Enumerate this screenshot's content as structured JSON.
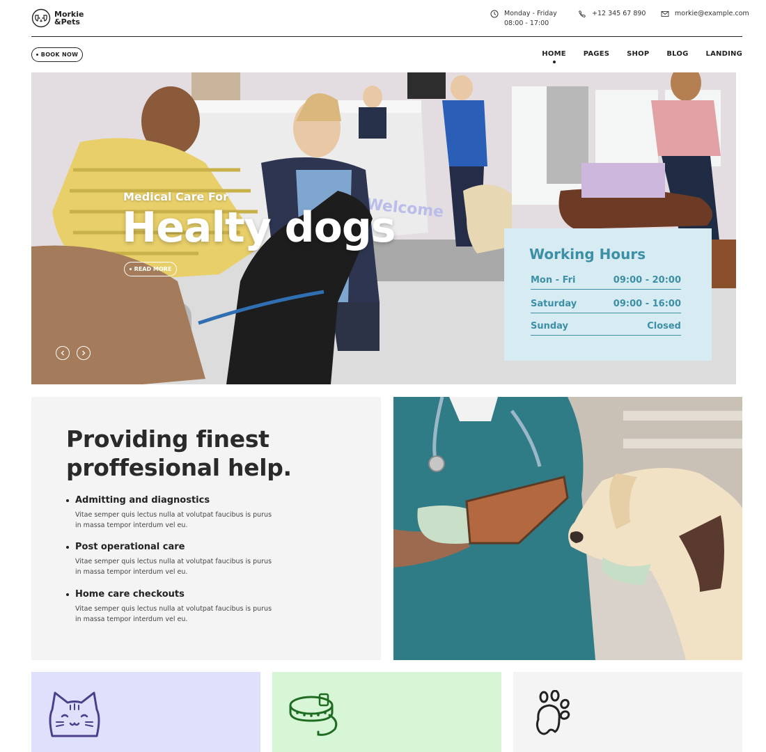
{
  "brand": {
    "line1": "Morkie",
    "line2": "&Pets"
  },
  "header": {
    "hours_line1": "Monday - Friday",
    "hours_line2": "08:00 - 17:00",
    "phone": "+12 345 67 890",
    "email": "morkie@example.com"
  },
  "nav": {
    "book_label": "BOOK NOW",
    "items": [
      "HOME",
      "PAGES",
      "SHOP",
      "BLOG",
      "LANDING"
    ],
    "active": "HOME"
  },
  "hero": {
    "subtitle": "Medical Care For",
    "title": "Healty dogs",
    "button": "READ MORE",
    "wall_sign": "Welcome"
  },
  "hours_card": {
    "title": "Working Hours",
    "rows": [
      {
        "day": "Mon - Fri",
        "time": "09:00 - 20:00"
      },
      {
        "day": "Saturday",
        "time": "09:00 - 16:00"
      },
      {
        "day": "Sunday",
        "time": "Closed"
      }
    ]
  },
  "services": {
    "title_line1": "Providing finest",
    "title_line2": "proffesional help.",
    "items": [
      {
        "title": "Admitting and diagnostics",
        "text_line1": "Vitae semper quis lectus nulla at volutpat faucibus is purus",
        "text_line2": "in massa tempor interdum vel eu."
      },
      {
        "title": "Post operational care",
        "text_line1": "Vitae semper quis lectus nulla at volutpat faucibus is purus",
        "text_line2": "in massa tempor interdum vel eu."
      },
      {
        "title": "Home care checkouts",
        "text_line1": "Vitae semper quis lectus nulla at volutpat faucibus is purus",
        "text_line2": "in massa tempor interdum vel eu."
      }
    ]
  },
  "cards": [
    {
      "icon": "cat-icon",
      "color": "#dfe0fc",
      "icon_color": "#4a3f8a"
    },
    {
      "icon": "collar-icon",
      "color": "#d6f6d6",
      "icon_color": "#1e6b22"
    },
    {
      "icon": "paw-icon",
      "color": "#f4f4f4",
      "icon_color": "#222222"
    }
  ],
  "colors": {
    "accent": "#3d8fa6",
    "text": "#222222",
    "hours_bg": "#d7ebf2"
  }
}
